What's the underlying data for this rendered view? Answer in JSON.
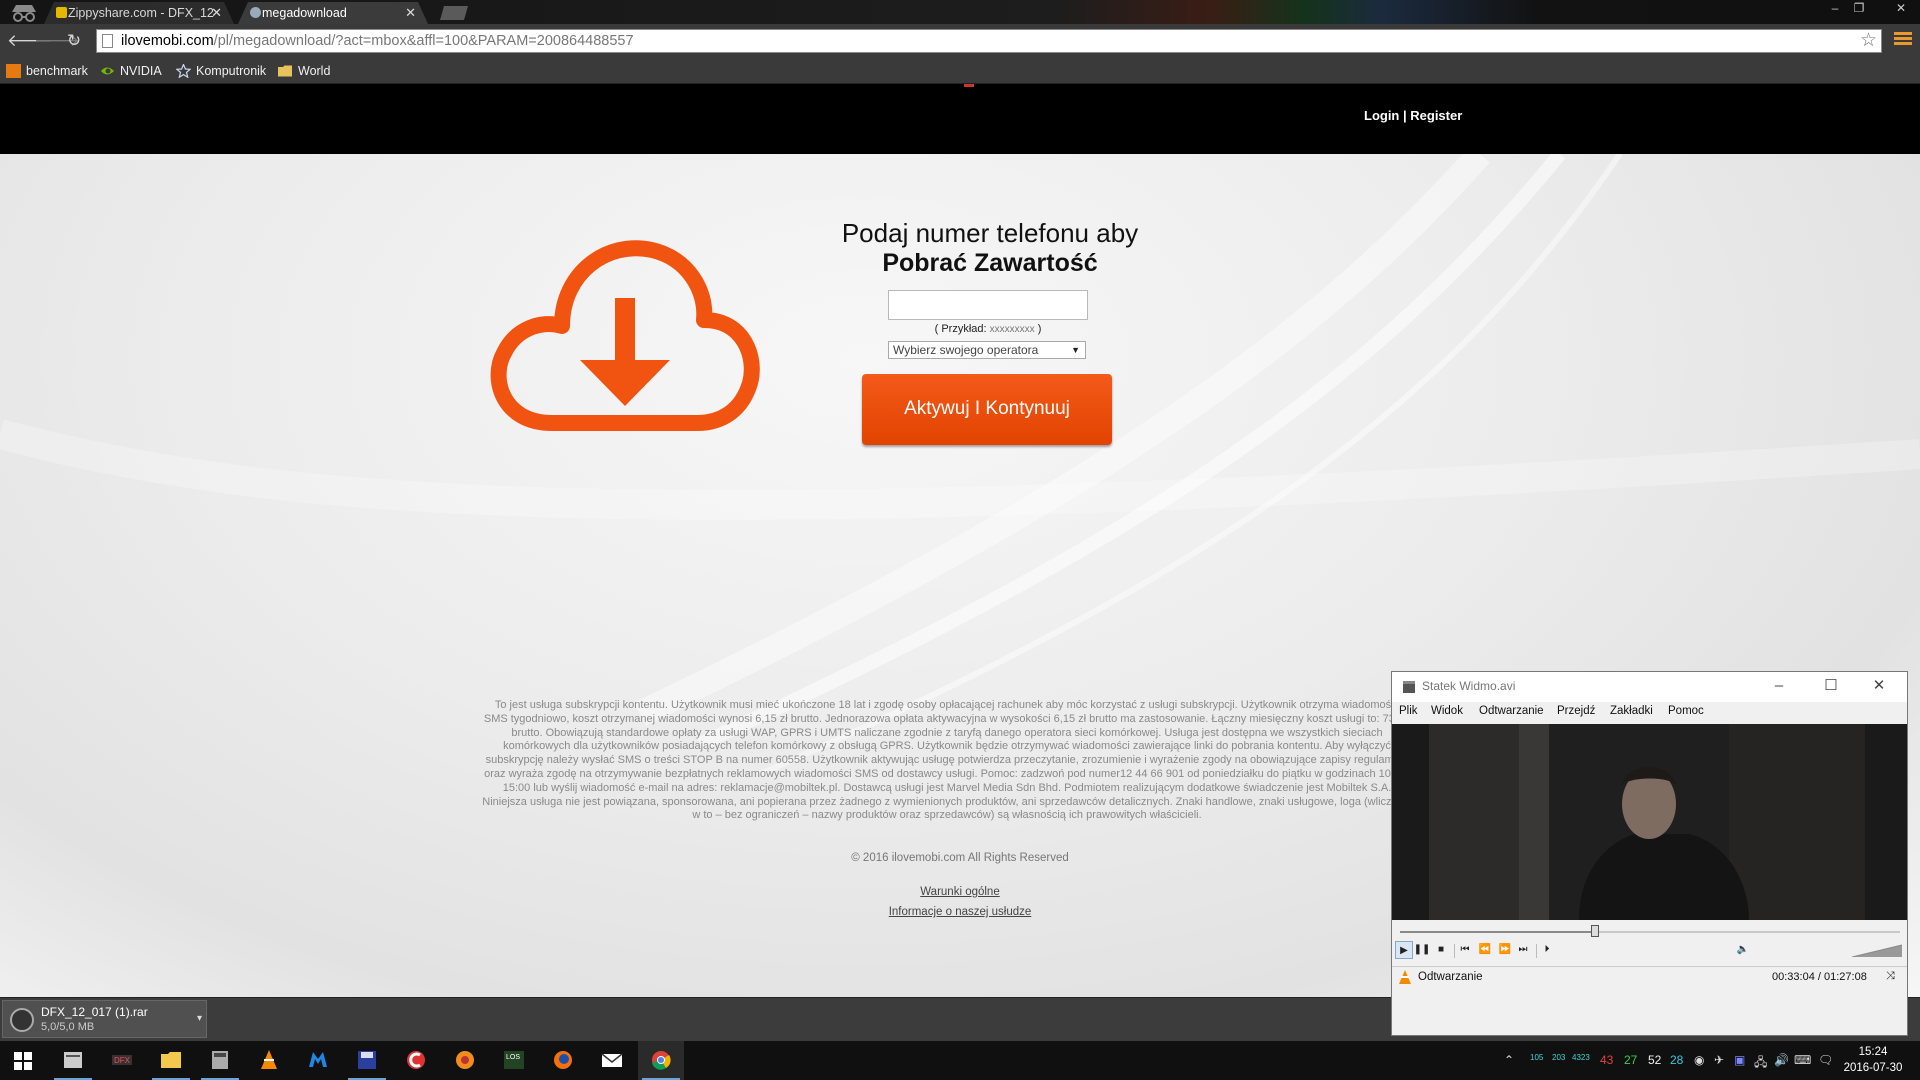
{
  "browser": {
    "tabs": [
      {
        "label": "Zippyshare.com - DFX_12",
        "active": false
      },
      {
        "label": "megadownload",
        "active": true
      }
    ],
    "url": {
      "host": "ilovemobi.com",
      "path": "/pl/megadownload/?act=mbox&affl=100&PARAM=200864488557"
    },
    "bookmarks": [
      {
        "label": "benchmark",
        "icon": "benchmark-icon"
      },
      {
        "label": "NVIDIA",
        "icon": "nvidia-icon"
      },
      {
        "label": "Komputronik",
        "icon": "star-icon"
      },
      {
        "label": "World",
        "icon": "folder-icon"
      }
    ]
  },
  "site": {
    "auth": {
      "login": "Login",
      "separator": " | ",
      "register": "Register"
    },
    "headline": {
      "line1": "Podaj numer telefonu aby",
      "line2": "Pobrać Zawartość"
    },
    "phone": {
      "value": "",
      "hint_label": "( Przykład:",
      "hint_example": "xxxxxxxxx",
      "hint_close": ")"
    },
    "operator": {
      "selected": "Wybierz swojego operatora"
    },
    "cta_label": "Aktywuj I Kontynuuj",
    "legal": "To jest usługa subskrypcji kontentu. Użytkownik musi mieć ukończone 18 lat i zgodę osoby opłacającej rachunek aby móc korzystać z usługi subskrypcji. Użytkownik otrzyma wiadomości SMS tygodniowo, koszt otrzymanej wiadomości wynosi 6,15 zł brutto. Jednorazowa opłata aktywacyjna w wysokości 6,15 zł brutto ma zastosowanie. Łączny miesięczny koszt usługi to: 73,80 brutto. Obowiązują standardowe opłaty za usługi WAP, GPRS i UMTS naliczane zgodnie z taryfą danego operatora sieci komórkowej. Usługa jest dostępna we wszystkich sieciach komórkowych dla użytkowników posiadających telefon komórkowy z obsługą GPRS. Użytkownik będzie otrzymywać wiadomości zawierające linki do pobrania kontentu. Aby wyłączyć subskrypcję należy wysłać SMS o treści STOP B na numer 60558. Użytkownik aktywując usługę potwierdza przeczytanie, zrozumienie i wyrażenie zgody na obowiązujące zapisy regulaminu oraz wyraża zgodę na otrzymywanie bezpłatnych reklamowych wiadomości SMS od dostawcy usługi. Pomoc: zadzwoń pod numer12 44 66 901 od poniedziałku do piątku w godzinach 10:00-15:00 lub wyślij wiadomość e-mail na adres: reklamacje@mobiltek.pl. Dostawcą usługi jest Marvel Media Sdn Bhd. Podmiotem realizującym dodatkowe świadczenie jest Mobiltek S.A. Niniejsza usługa nie jest powiązana, sponsorowana, ani popierana przez żadnego z wymienionych produktów, ani sprzedawców detalicznych. Znaki handlowe, znaki usługowe, loga (wliczając w to – bez ograniczeń – nazwy produktów oraz sprzedawców) są własnością ich prawowitych właścicieli.",
    "copyright": "© 2016 ilovemobi.com All Rights Reserved",
    "links": {
      "terms": "Warunki ogólne",
      "info": "Informacje o naszej usłudze"
    },
    "accent_color": "#f05410"
  },
  "download_shelf": {
    "file_name": "DFX_12_017 (1).rar",
    "size": "5,0/5,0 MB"
  },
  "vlc": {
    "title": "Statek Widmo.avi",
    "menu": [
      "Plik",
      "Widok",
      "Odtwarzanie",
      "Przejdź",
      "Zakładki",
      "Pomoc"
    ],
    "progress": 0.39,
    "volume": 1.0,
    "status": "Odtwarzanie",
    "time": "00:33:04 / 01:27:08"
  },
  "taskbar": {
    "apps": [
      "file-manager-icon",
      "dfx-icon",
      "explorer-icon",
      "calculator-icon",
      "vlc-icon",
      "malwarebytes-icon",
      "save-icon",
      "ccleaner-icon",
      "media-icon",
      "los-icon",
      "firefox-icon",
      "mail-icon",
      "chrome-icon"
    ],
    "tray": {
      "temps": [
        "105",
        "203",
        "4323"
      ],
      "red": "43",
      "green": "27",
      "white": "52",
      "cyan": "28"
    },
    "clock": {
      "time": "15:24",
      "date": "2016-07-30"
    }
  }
}
